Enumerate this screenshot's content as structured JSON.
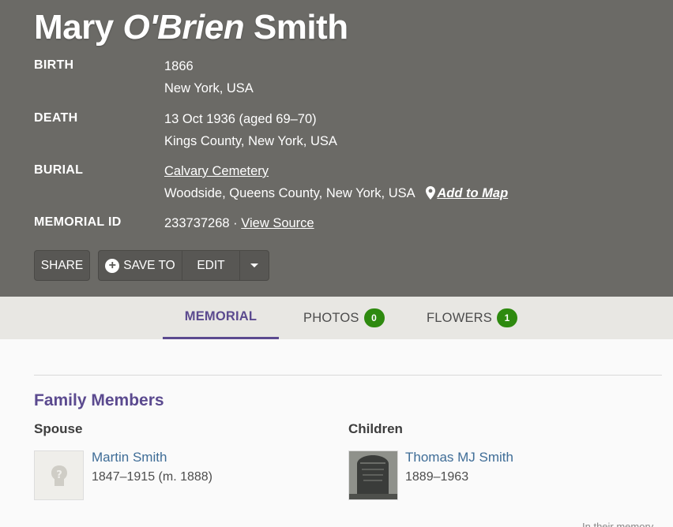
{
  "memorial": {
    "first_name": "Mary",
    "maiden_name": "O'Brien",
    "last_name": "Smith",
    "birth_label": "BIRTH",
    "birth_date": "1866",
    "birth_place": "New York, USA",
    "death_label": "DEATH",
    "death_date": "13 Oct 1936 (aged 69–70)",
    "death_place": "Kings County, New York, USA",
    "burial_label": "BURIAL",
    "burial_cemetery": "Calvary Cemetery",
    "burial_place": "Woodside, Queens County, New York, USA",
    "add_to_map": "Add to Map",
    "id_label": "MEMORIAL ID",
    "memorial_id": "233737268 ·",
    "view_source": "View Source"
  },
  "actions": {
    "share": "SHARE",
    "save_to": "SAVE TO",
    "edit": "EDIT"
  },
  "tabs": {
    "memorial": "MEMORIAL",
    "photos": "PHOTOS",
    "photos_count": "0",
    "flowers": "FLOWERS",
    "flowers_count": "1"
  },
  "family": {
    "title": "Family Members",
    "spouse_label": "Spouse",
    "children_label": "Children",
    "spouse": {
      "name": "Martin Smith",
      "dates": "1847–1915 (m. 1888)"
    },
    "child": {
      "name": "Thomas MJ Smith",
      "dates": "1889–1963"
    }
  },
  "footer": {
    "peek_text": "In their memory"
  },
  "colors": {
    "header_bg": "#6b6a66",
    "accent": "#5b4a8f",
    "badge": "#2e8a0f",
    "link": "#3f6d97"
  },
  "icons": [
    "map-pin-icon",
    "plus-circle-icon",
    "caret-down-icon",
    "unknown-person-icon"
  ]
}
